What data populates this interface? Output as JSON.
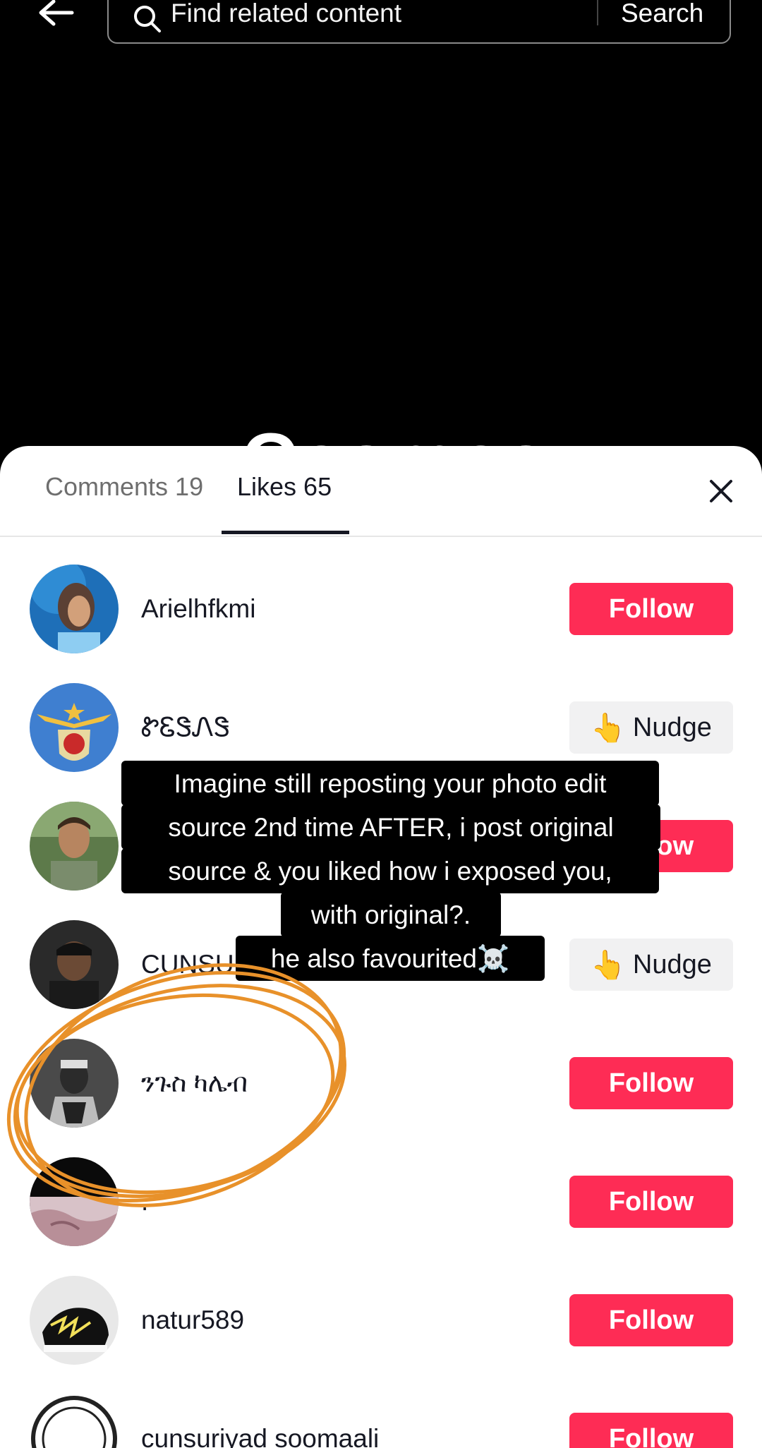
{
  "search": {
    "placeholder": "Find related content",
    "button_label": "Search"
  },
  "background": {
    "video_text": "Cosmos"
  },
  "tabs": [
    {
      "label": "Comments 19",
      "active": false
    },
    {
      "label": "Likes 65",
      "active": true
    }
  ],
  "likes_list": [
    {
      "username": "Arielhfkmi",
      "action": "Follow"
    },
    {
      "username": "ᏑᏋᏕᏁᏕ",
      "action": "Nudge",
      "action_emoji": "👆"
    },
    {
      "username": "",
      "action": "Follow"
    },
    {
      "username": "CUNSU",
      "action": "Nudge",
      "action_emoji": "👆"
    },
    {
      "username": "ንጉስ ካሌብ",
      "action": "Follow"
    },
    {
      "username": ".",
      "action": "Follow"
    },
    {
      "username": "natur589",
      "action": "Follow"
    },
    {
      "username": "cunsuriyad soomaali",
      "action": "Follow"
    }
  ],
  "caption": {
    "lines": [
      "Imagine still reposting your photo edit",
      "source 2nd time AFTER, i post original",
      "source & you liked how i exposed you,",
      "with original?.",
      "he also favourited☠️"
    ]
  },
  "colors": {
    "follow_button": "#fe2c55",
    "nudge_button": "#f1f1f2",
    "annotation_circle": "#e8912a"
  }
}
